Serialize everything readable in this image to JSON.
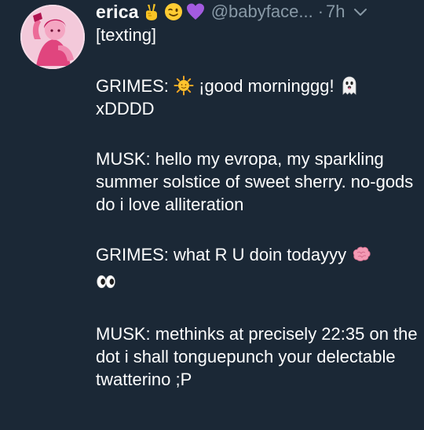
{
  "tweet": {
    "display_name": "erica",
    "handle": "@babyface...",
    "separator": "·",
    "time": "7h",
    "name_emojis": [
      "victory-hand-icon",
      "winking-face-icon",
      "purple-heart-icon"
    ],
    "body": {
      "line1": "[texting]",
      "grimes1_label": "GRIMES:",
      "grimes1_text": "¡good morninggg!",
      "grimes1_tail": "xDDDD",
      "musk1": "MUSK: hello my evropa, my sparkling summer solstice of sweet sherry. no-gods do i love alliteration",
      "grimes2": "GRIMES: what R U doin todayyy",
      "musk2": "MUSK: methinks at precisely 22:35 on the dot i shall tonguepunch your delectable twatterino ;P"
    }
  },
  "colors": {
    "background": "#1b2836",
    "text": "#ffffff",
    "muted": "#8899a6"
  }
}
